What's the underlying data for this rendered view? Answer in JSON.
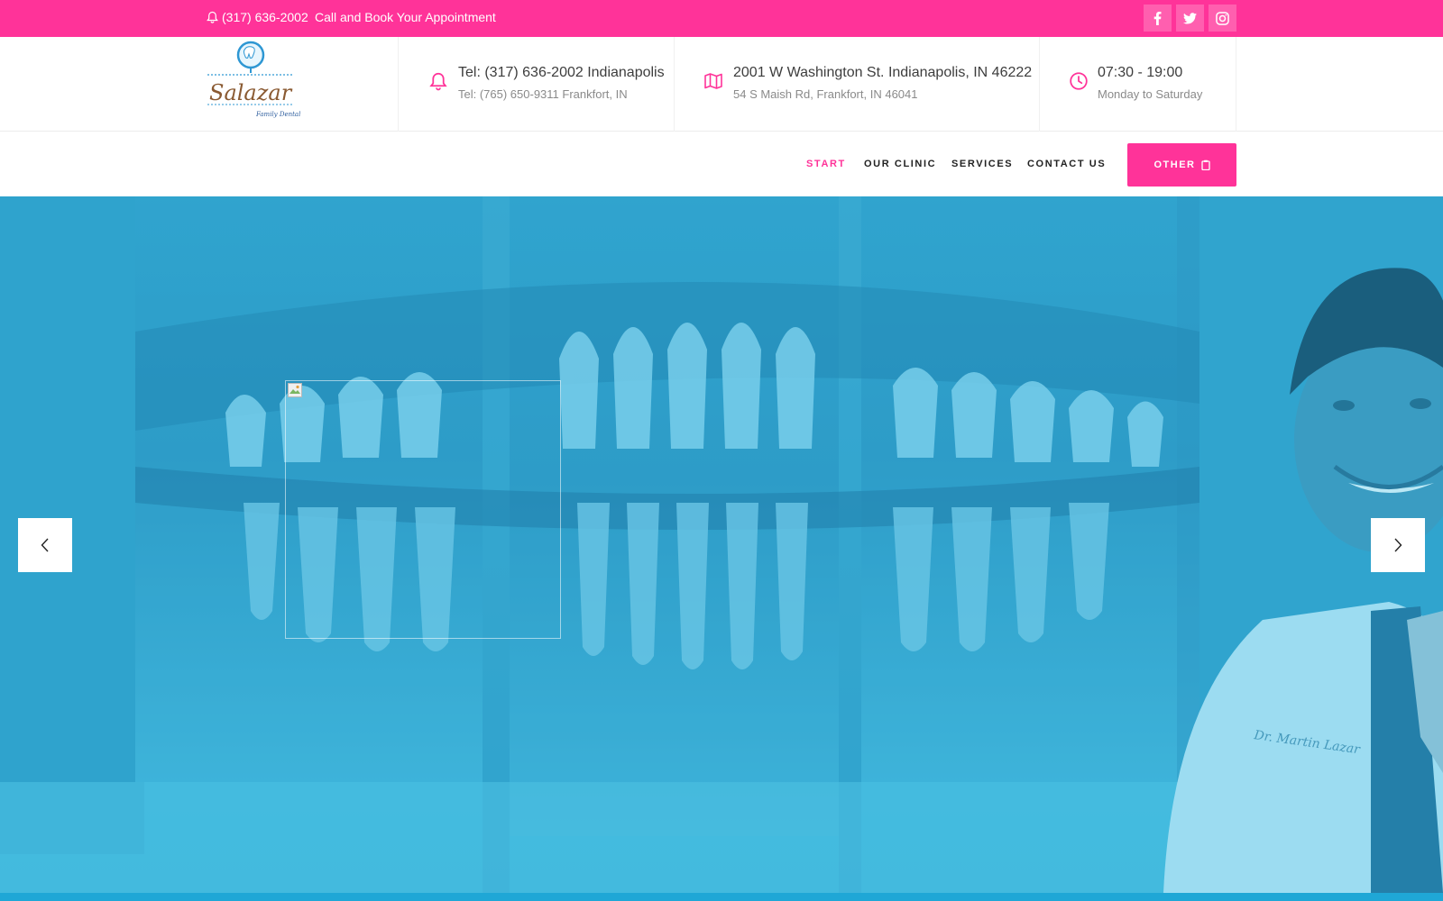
{
  "topbar": {
    "phone": "(317) 636-2002",
    "callout": "Call and Book Your Appointment",
    "social": [
      "facebook-icon",
      "twitter-icon",
      "instagram-icon"
    ]
  },
  "logo": {
    "name": "Salazar",
    "tagline": "Family Dental"
  },
  "info": {
    "phones": {
      "line1": "Tel: (317) 636-2002 Indianapolis",
      "line2": "Tel: (765) 650-9311 Frankfort, IN"
    },
    "address": {
      "line1": "2001 W Washington St. Indianapolis, IN 46222",
      "line2": "54 S Maish Rd, Frankfort, IN 46041"
    },
    "hours": {
      "line1": "07:30 - 19:00",
      "line2": "Monday to Saturday"
    }
  },
  "nav": {
    "items": [
      "START",
      "OUR CLINIC",
      "SERVICES",
      "CONTACT US"
    ],
    "active": "START",
    "other_label": "OTHER"
  },
  "hero": {
    "coat_text": "Dr. Martin Lazar"
  },
  "colors": {
    "accent": "#ff3399",
    "hero_tint": "#3bb4d9",
    "strip": "#1fa7d6"
  }
}
